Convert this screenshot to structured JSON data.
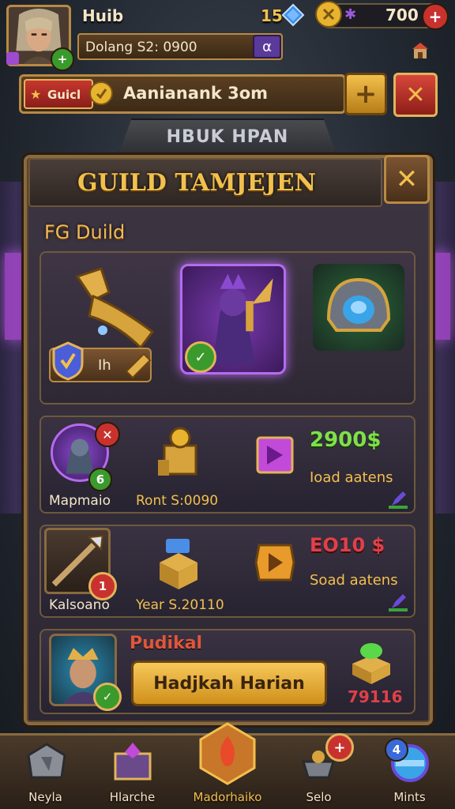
{
  "player": {
    "name": "Huib",
    "level_badge": "+"
  },
  "currencies": {
    "gems": "15",
    "gold": "700",
    "add": "+"
  },
  "status_bar": {
    "text": "Dolang S2: 0900",
    "button": "α"
  },
  "guild_banner": {
    "tag": "Guicl",
    "text": "Aanianank 3om",
    "plus": "+",
    "close": "✕"
  },
  "sign": {
    "text": "HBUK HPAN"
  },
  "panel": {
    "title": "GUILD TAMJEJEN",
    "close": "✕",
    "subtitle": "FG Duild",
    "featured": {
      "bar_label": "Ih"
    },
    "rows": [
      {
        "avatar_label": "Mapmaio",
        "center_label": "Ront S:0090",
        "price": "2900$",
        "action": "Ioad aatens",
        "badge": "6",
        "remove": "✕"
      },
      {
        "avatar_label": "Kalsoano",
        "center_label": "Year S.20110",
        "price": "EO10 $",
        "action": "Soad aatens",
        "badge": "1"
      },
      {
        "name": "Pudikal",
        "button": "Hadjkah Harian",
        "count": "79116"
      }
    ]
  },
  "nav": {
    "tabs": [
      {
        "label": "Neyla"
      },
      {
        "label": "Hlarche"
      },
      {
        "label": "Madorhaiko"
      },
      {
        "label": "Selo"
      },
      {
        "label": "Mints"
      }
    ],
    "selo_badge": "+",
    "mints_badge": "4"
  },
  "colors": {
    "gold": "#f2c04d",
    "green": "#7ee04a",
    "red": "#e04848",
    "purple": "#9a4ad6",
    "panel": "#3b3340"
  }
}
